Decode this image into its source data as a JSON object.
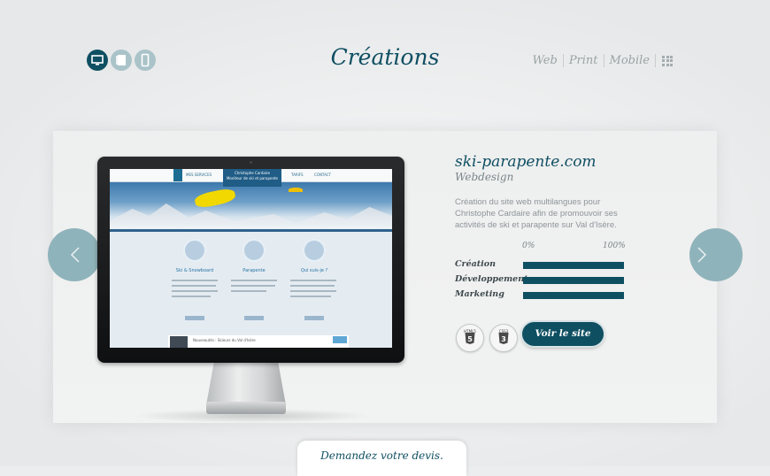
{
  "header": {
    "title": "Créations",
    "device_icons": [
      {
        "name": "desktop-icon",
        "active": true
      },
      {
        "name": "tablet-icon",
        "active": false
      },
      {
        "name": "phone-icon",
        "active": false
      }
    ],
    "filters": [
      "Web",
      "Print",
      "Mobile"
    ],
    "grid_icon": "grid-icon"
  },
  "project": {
    "name": "ski-parapente.com",
    "category": "Webdesign",
    "description": "Création du site web multilangues pour Christophe Cardaire afin de promouvoir ses activités de ski et parapente sur Val d'Isère.",
    "scale_min": "0%",
    "scale_max": "100%",
    "skills": [
      {
        "label": "Création",
        "value": 100
      },
      {
        "label": "Développement",
        "value": 100
      },
      {
        "label": "Marketing",
        "value": 100
      }
    ],
    "technologies": [
      "HTML5",
      "CSS3"
    ],
    "visit_label": "Voir le site"
  },
  "preview": {
    "nav_items": [
      "MES SERVICES",
      "TARIFS",
      "CONTACT"
    ],
    "logo_name": "Christophe Cardaire",
    "logo_sub": "Moniteur de ski et parapente",
    "sections": [
      "Ski & Snowboard",
      "Parapente",
      "Qui suis-je ?"
    ],
    "footer_text": "Nouveautés : Skieurs du Val d'Isère"
  },
  "cta": {
    "label": "Demandez votre devis."
  },
  "colors": {
    "accent": "#0f4f62",
    "arrow": "#8fb3ba",
    "muted": "#9aa3a6"
  }
}
